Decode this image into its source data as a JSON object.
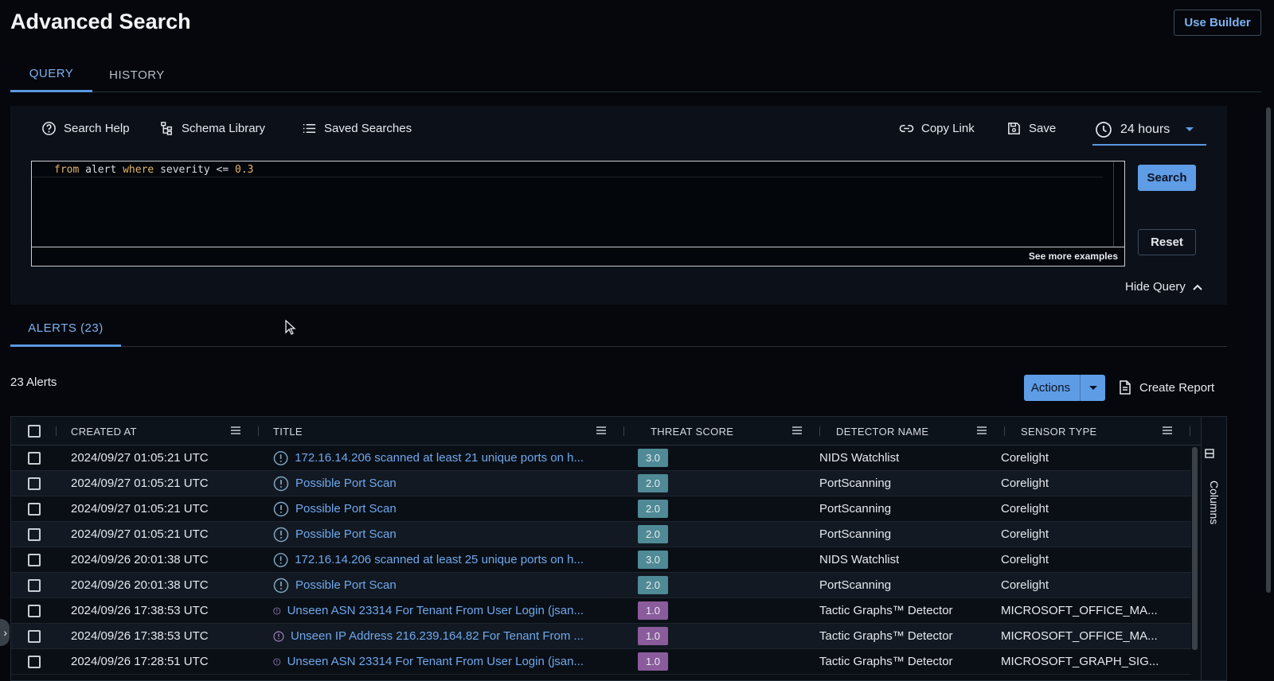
{
  "page": {
    "title": "Advanced Search",
    "use_builder": "Use Builder"
  },
  "tabs": [
    {
      "label": "QUERY",
      "active": true
    },
    {
      "label": "HISTORY",
      "active": false
    }
  ],
  "toolbar": {
    "search_help": "Search Help",
    "schema_library": "Schema Library",
    "saved_searches": "Saved Searches",
    "copy_link": "Copy Link",
    "save": "Save",
    "time_range": "24 hours"
  },
  "query": {
    "kw_from": "from",
    "src": "alert",
    "kw_where": "where",
    "field": "severity",
    "op": "<=",
    "value": "0.3",
    "see_more": "See more examples"
  },
  "buttons": {
    "search": "Search",
    "reset": "Reset",
    "hide_query": "Hide Query"
  },
  "results": {
    "tab_label": "ALERTS (23)",
    "count_label": "23 Alerts",
    "actions": "Actions",
    "create_report": "Create Report",
    "columns_label": "Columns"
  },
  "table": {
    "columns": [
      "CREATED AT",
      "TITLE",
      "THREAT SCORE",
      "DETECTOR NAME",
      "SENSOR TYPE"
    ],
    "rows": [
      {
        "created": "2024/09/27 01:05:21 UTC",
        "title": "172.16.14.206 scanned at least 21 unique ports on h...",
        "score": "3.0",
        "score_color": "#4f8a96",
        "icon_color": "#7fa7c2",
        "detector": "NIDS Watchlist",
        "sensor": "Corelight"
      },
      {
        "created": "2024/09/27 01:05:21 UTC",
        "title": "Possible Port Scan",
        "score": "2.0",
        "score_color": "#4f8a96",
        "icon_color": "#7fa7c2",
        "detector": "PortScanning",
        "sensor": "Corelight"
      },
      {
        "created": "2024/09/27 01:05:21 UTC",
        "title": "Possible Port Scan",
        "score": "2.0",
        "score_color": "#4f8a96",
        "icon_color": "#7fa7c2",
        "detector": "PortScanning",
        "sensor": "Corelight"
      },
      {
        "created": "2024/09/27 01:05:21 UTC",
        "title": "Possible Port Scan",
        "score": "2.0",
        "score_color": "#4f8a96",
        "icon_color": "#7fa7c2",
        "detector": "PortScanning",
        "sensor": "Corelight"
      },
      {
        "created": "2024/09/26 20:01:38 UTC",
        "title": "172.16.14.206 scanned at least 25 unique ports on h...",
        "score": "3.0",
        "score_color": "#4f8a96",
        "icon_color": "#7fa7c2",
        "detector": "NIDS Watchlist",
        "sensor": "Corelight"
      },
      {
        "created": "2024/09/26 20:01:38 UTC",
        "title": "Possible Port Scan",
        "score": "2.0",
        "score_color": "#4f8a96",
        "icon_color": "#7fa7c2",
        "detector": "PortScanning",
        "sensor": "Corelight"
      },
      {
        "created": "2024/09/26 17:38:53 UTC",
        "title": "Unseen ASN 23314 For Tenant From User Login (jsan...",
        "score": "1.0",
        "score_color": "#8a5c9c",
        "icon_color": "#b38bd0",
        "detector": "Tactic Graphs™ Detector",
        "sensor": "MICROSOFT_OFFICE_MA..."
      },
      {
        "created": "2024/09/26 17:38:53 UTC",
        "title": "Unseen IP Address 216.239.164.82 For Tenant From ...",
        "score": "1.0",
        "score_color": "#8a5c9c",
        "icon_color": "#b38bd0",
        "detector": "Tactic Graphs™ Detector",
        "sensor": "MICROSOFT_OFFICE_MA..."
      },
      {
        "created": "2024/09/26 17:28:51 UTC",
        "title": "Unseen ASN 23314 For Tenant From User Login (jsan...",
        "score": "1.0",
        "score_color": "#8a5c9c",
        "icon_color": "#b38bd0",
        "detector": "Tactic Graphs™ Detector",
        "sensor": "MICROSOFT_GRAPH_SIG..."
      }
    ]
  },
  "colors": {
    "accent": "#5f9ce6",
    "link": "#6fa8ec",
    "background": "#05070c"
  }
}
